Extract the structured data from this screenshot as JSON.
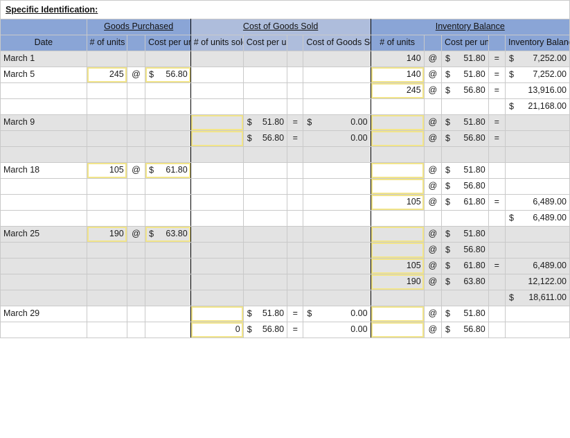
{
  "title": "Specific Identification:",
  "headers": {
    "groups": {
      "blank": "",
      "goods_purchased": "Goods Purchased",
      "cost_of_goods_sold": "Cost of Goods Sold",
      "inventory_balance": "Inventory Balance"
    },
    "sub": {
      "date": "Date",
      "gp_units": "# of units",
      "gp_at": "",
      "gp_cost": "Cost per unit",
      "cs_units": "# of units sold",
      "cs_cost": "Cost per unit",
      "cs_eq": "",
      "cs_total": "Cost of Goods Sold",
      "ib_units": "# of units",
      "ib_at": "",
      "ib_cost": "Cost per unit",
      "ib_eq": "",
      "ib_total": "Inventory Balance"
    }
  },
  "symbols": {
    "at": "@",
    "equals": "=",
    "dollar": "$"
  },
  "colors": {
    "header_blue": "#8aa5d6",
    "header_blue_light": "#aebddc",
    "row_gray": "#e3e3e3",
    "input_outline": "#f2e58a",
    "grid_line": "#c9c9c9"
  },
  "rows": [
    {
      "date": "March 1",
      "fill": "gray",
      "gp": {
        "units": "",
        "at": "",
        "cost": ""
      },
      "cs": {
        "units": "",
        "cost": "",
        "eq": "",
        "total": ""
      },
      "ib": {
        "units": "140",
        "at": "@",
        "cost": "51.80",
        "cost_sym": "$",
        "eq": "=",
        "total": "7,252.00",
        "total_sym": "$"
      }
    },
    {
      "date": "March 5",
      "fill": "white",
      "gp": {
        "units": "245",
        "at": "@",
        "cost": "56.80",
        "cost_sym": "$"
      },
      "cs": {
        "units": "",
        "cost": "",
        "eq": "",
        "total": ""
      },
      "ib": {
        "units": "140",
        "at": "@",
        "cost": "51.80",
        "cost_sym": "$",
        "eq": "=",
        "total": "7,252.00",
        "total_sym": "$"
      }
    },
    {
      "date": "",
      "fill": "white",
      "gp": {
        "units": "",
        "at": "",
        "cost": ""
      },
      "cs": {
        "units": "",
        "cost": "",
        "eq": "",
        "total": ""
      },
      "ib": {
        "units": "245",
        "at": "@",
        "cost": "56.80",
        "cost_sym": "$",
        "eq": "=",
        "total": "13,916.00",
        "total_sym": ""
      }
    },
    {
      "date": "",
      "fill": "white",
      "gp": {
        "units": "",
        "at": "",
        "cost": ""
      },
      "cs": {
        "units": "",
        "cost": "",
        "eq": "",
        "total": ""
      },
      "ib": {
        "units": "",
        "at": "",
        "cost": "",
        "eq": "",
        "total": "21,168.00",
        "total_sym": "$"
      }
    },
    {
      "date": "March 9",
      "fill": "gray",
      "gp": {
        "units": "",
        "at": "",
        "cost": ""
      },
      "cs": {
        "units": "",
        "cost": "51.80",
        "cost_sym": "$",
        "eq": "=",
        "total": "0.00",
        "total_sym": "$"
      },
      "ib": {
        "units": "",
        "at": "@",
        "cost": "51.80",
        "cost_sym": "$",
        "eq": "=",
        "total": ""
      }
    },
    {
      "date": "",
      "fill": "gray",
      "gp": {
        "units": "",
        "at": "",
        "cost": ""
      },
      "cs": {
        "units": "",
        "cost": "56.80",
        "cost_sym": "$",
        "eq": "=",
        "total": "0.00",
        "total_sym": ""
      },
      "ib": {
        "units": "",
        "at": "@",
        "cost": "56.80",
        "cost_sym": "$",
        "eq": "=",
        "total": ""
      }
    },
    {
      "date": "",
      "fill": "gray",
      "gp": {
        "units": "",
        "at": "",
        "cost": ""
      },
      "cs": {
        "units": "",
        "cost": "",
        "eq": "",
        "total": ""
      },
      "ib": {
        "units": "",
        "at": "",
        "cost": "",
        "eq": "",
        "total": ""
      }
    },
    {
      "date": "March 18",
      "fill": "white",
      "gp": {
        "units": "105",
        "at": "@",
        "cost": "61.80",
        "cost_sym": "$"
      },
      "cs": {
        "units": "",
        "cost": "",
        "eq": "",
        "total": ""
      },
      "ib": {
        "units": "",
        "at": "@",
        "cost": "51.80",
        "cost_sym": "$",
        "eq": "",
        "total": ""
      }
    },
    {
      "date": "",
      "fill": "white",
      "gp": {
        "units": "",
        "at": "",
        "cost": ""
      },
      "cs": {
        "units": "",
        "cost": "",
        "eq": "",
        "total": ""
      },
      "ib": {
        "units": "",
        "at": "@",
        "cost": "56.80",
        "cost_sym": "$",
        "eq": "",
        "total": ""
      }
    },
    {
      "date": "",
      "fill": "white",
      "gp": {
        "units": "",
        "at": "",
        "cost": ""
      },
      "cs": {
        "units": "",
        "cost": "",
        "eq": "",
        "total": ""
      },
      "ib": {
        "units": "105",
        "at": "@",
        "cost": "61.80",
        "cost_sym": "$",
        "eq": "=",
        "total": "6,489.00",
        "total_sym": ""
      }
    },
    {
      "date": "",
      "fill": "white",
      "gp": {
        "units": "",
        "at": "",
        "cost": ""
      },
      "cs": {
        "units": "",
        "cost": "",
        "eq": "",
        "total": ""
      },
      "ib": {
        "units": "",
        "at": "",
        "cost": "",
        "eq": "",
        "total": "6,489.00",
        "total_sym": "$"
      }
    },
    {
      "date": "March 25",
      "fill": "gray",
      "gp": {
        "units": "190",
        "at": "@",
        "cost": "63.80",
        "cost_sym": "$"
      },
      "cs": {
        "units": "",
        "cost": "",
        "eq": "",
        "total": ""
      },
      "ib": {
        "units": "",
        "at": "@",
        "cost": "51.80",
        "cost_sym": "$",
        "eq": "",
        "total": ""
      }
    },
    {
      "date": "",
      "fill": "gray",
      "gp": {
        "units": "",
        "at": "",
        "cost": ""
      },
      "cs": {
        "units": "",
        "cost": "",
        "eq": "",
        "total": ""
      },
      "ib": {
        "units": "",
        "at": "@",
        "cost": "56.80",
        "cost_sym": "$",
        "eq": "",
        "total": ""
      }
    },
    {
      "date": "",
      "fill": "gray",
      "gp": {
        "units": "",
        "at": "",
        "cost": ""
      },
      "cs": {
        "units": "",
        "cost": "",
        "eq": "",
        "total": ""
      },
      "ib": {
        "units": "105",
        "at": "@",
        "cost": "61.80",
        "cost_sym": "$",
        "eq": "=",
        "total": "6,489.00",
        "total_sym": ""
      }
    },
    {
      "date": "",
      "fill": "gray",
      "gp": {
        "units": "",
        "at": "",
        "cost": ""
      },
      "cs": {
        "units": "",
        "cost": "",
        "eq": "",
        "total": ""
      },
      "ib": {
        "units": "190",
        "at": "@",
        "cost": "63.80",
        "cost_sym": "$",
        "eq": "",
        "total": "12,122.00",
        "total_sym": ""
      }
    },
    {
      "date": "",
      "fill": "gray",
      "gp": {
        "units": "",
        "at": "",
        "cost": ""
      },
      "cs": {
        "units": "",
        "cost": "",
        "eq": "",
        "total": ""
      },
      "ib": {
        "units": "",
        "at": "",
        "cost": "",
        "eq": "",
        "total": "18,611.00",
        "total_sym": "$"
      }
    },
    {
      "date": "March 29",
      "fill": "white",
      "gp": {
        "units": "",
        "at": "",
        "cost": ""
      },
      "cs": {
        "units": "",
        "cost": "51.80",
        "cost_sym": "$",
        "eq": "=",
        "total": "0.00",
        "total_sym": "$"
      },
      "ib": {
        "units": "",
        "at": "@",
        "cost": "51.80",
        "cost_sym": "$",
        "eq": "",
        "total": ""
      }
    },
    {
      "date": "",
      "fill": "white",
      "gp": {
        "units": "",
        "at": "",
        "cost": ""
      },
      "cs": {
        "units": "0",
        "cost": "56.80",
        "cost_sym": "$",
        "eq": "=",
        "total": "0.00",
        "total_sym": ""
      },
      "ib": {
        "units": "",
        "at": "@",
        "cost": "56.80",
        "cost_sym": "$",
        "eq": "",
        "total": ""
      }
    }
  ]
}
